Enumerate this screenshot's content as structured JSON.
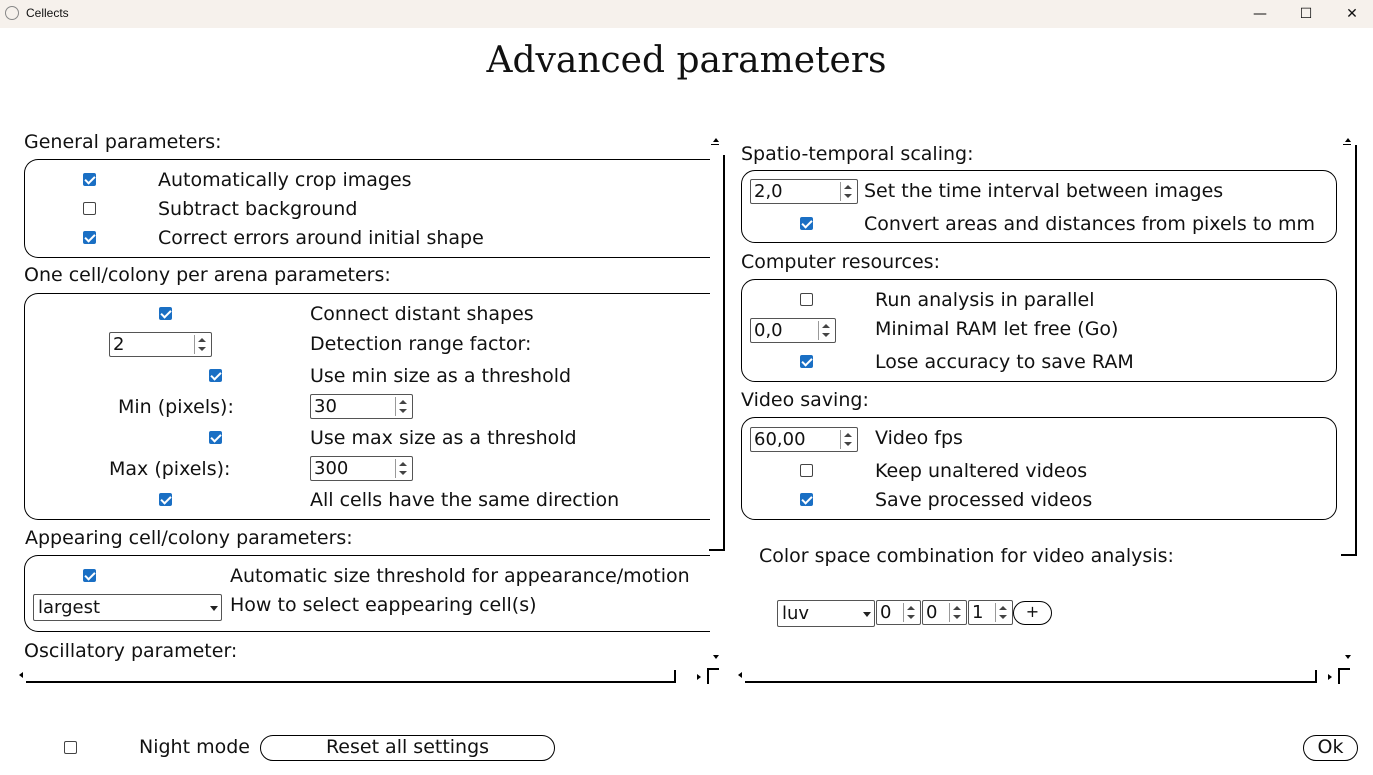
{
  "window": {
    "title": "Cellects",
    "minimize_icon": "minimize-icon",
    "maximize_icon": "maximize-icon",
    "close_icon": "close-icon"
  },
  "page_title": "Advanced parameters",
  "general": {
    "heading": "General parameters:",
    "auto_crop": {
      "label": "Automatically crop images",
      "checked": true
    },
    "subtract_bg": {
      "label": "Subtract background",
      "checked": false
    },
    "correct_errors": {
      "label": "Correct errors around initial shape",
      "checked": true
    }
  },
  "one_cell": {
    "heading": "One cell/colony per arena parameters:",
    "connect_distant": {
      "label": "Connect distant shapes",
      "checked": true
    },
    "detection_range": {
      "label": "Detection range factor:",
      "value": "2"
    },
    "use_min": {
      "label": "Use min size as a threshold",
      "checked": true
    },
    "min": {
      "label": "Min (pixels):",
      "value": "30"
    },
    "use_max": {
      "label": "Use max size as a threshold",
      "checked": true
    },
    "max": {
      "label": "Max (pixels):",
      "value": "300"
    },
    "same_direction": {
      "label": "All cells have the same direction",
      "checked": true
    }
  },
  "appearing": {
    "heading": "Appearing cell/colony parameters:",
    "auto_threshold": {
      "label": "Automatic size threshold for appearance/motion",
      "checked": true
    },
    "select_method": {
      "label": "How to select eappearing cell(s)",
      "value": "largest"
    }
  },
  "oscillatory": {
    "heading": "Oscillatory parameter:"
  },
  "spatio": {
    "heading": "Spatio-temporal scaling:",
    "interval": {
      "label": "Set the time interval between images",
      "value": "2,0"
    },
    "convert": {
      "label": "Convert areas and distances from pixels to mm",
      "checked": true
    }
  },
  "resources": {
    "heading": "Computer resources:",
    "parallel": {
      "label": "Run analysis in parallel",
      "checked": false
    },
    "ram": {
      "label": "Minimal RAM let free (Go)",
      "value": "0,0"
    },
    "lose_accuracy": {
      "label": "Lose accuracy to save RAM",
      "checked": true
    }
  },
  "video": {
    "heading": "Video saving:",
    "fps": {
      "label": "Video fps",
      "value": "60,00"
    },
    "keep_unaltered": {
      "label": "Keep unaltered videos",
      "checked": false
    },
    "save_processed": {
      "label": "Save processed videos",
      "checked": true
    }
  },
  "color_space": {
    "heading": "Color space combination for video analysis:",
    "space": "luv",
    "c1": "0",
    "c2": "0",
    "c3": "1",
    "add_label": "+"
  },
  "footer": {
    "night_mode": {
      "label": "Night mode",
      "checked": false
    },
    "reset_label": "Reset all settings",
    "ok_label": "Ok"
  }
}
